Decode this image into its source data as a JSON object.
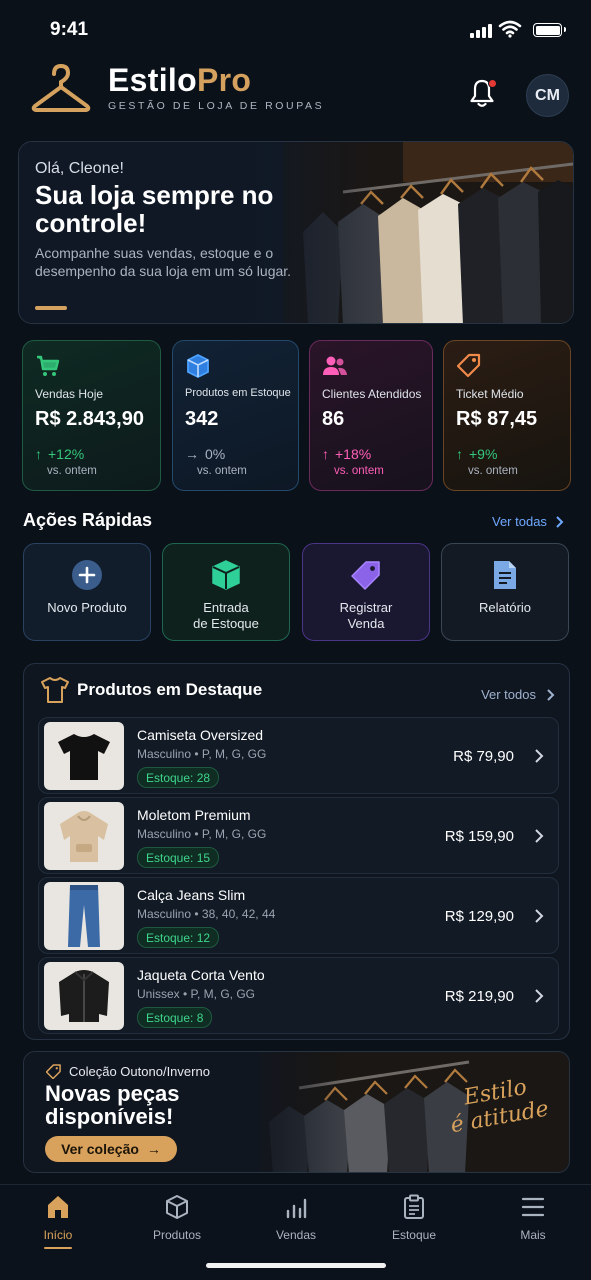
{
  "status_bar": {
    "time": "9:41"
  },
  "header": {
    "brand_part1": "Estilo",
    "brand_part2": "Pro",
    "tagline": "GESTÃO DE LOJA DE ROUPAS",
    "avatar_initials": "CM"
  },
  "hero": {
    "greeting": "Olá, Cleone!",
    "title": "Sua loja sempre no controle!",
    "description": "Acompanhe suas vendas, estoque e o desempenho da sua loja em um só lugar."
  },
  "stats": [
    {
      "label": "Vendas Hoje",
      "value": "R$ 2.843,90",
      "change": "+12%",
      "compare": "vs. ontem",
      "icon": "cart-icon",
      "color": "#34c77b"
    },
    {
      "label": "Produtos em Estoque",
      "value": "342",
      "change": "0%",
      "compare": "vs. ontem",
      "icon": "box-icon",
      "color": "#4ea3ff"
    },
    {
      "label": "Clientes Atendidos",
      "value": "86",
      "change": "+18%",
      "compare": "vs. ontem",
      "icon": "users-icon",
      "color": "#ff5fb8"
    },
    {
      "label": "Ticket Médio",
      "value": "R$ 87,45",
      "change": "+9%",
      "compare": "vs. ontem",
      "icon": "tag-icon",
      "color": "#f08a4b"
    }
  ],
  "quick_actions": {
    "title": "Ações Rápidas",
    "link": "Ver todas",
    "items": [
      {
        "label": "Novo Produto",
        "icon": "plus-icon"
      },
      {
        "label": "Entrada\nde Estoque",
        "icon": "box-in-icon"
      },
      {
        "label": "Registrar\nVenda",
        "icon": "tag-icon"
      },
      {
        "label": "Relatório",
        "icon": "document-icon"
      }
    ]
  },
  "featured": {
    "title": "Produtos em Destaque",
    "link": "Ver todos",
    "products": [
      {
        "name": "Camiseta Oversized",
        "meta": "Masculino  •  P, M, G, GG",
        "stock": "Estoque: 28",
        "price": "R$ 79,90",
        "image": "tshirt-image"
      },
      {
        "name": "Moletom Premium",
        "meta": "Masculino  •  P, M, G, GG",
        "stock": "Estoque: 15",
        "price": "R$ 159,90",
        "image": "hoodie-image"
      },
      {
        "name": "Calça Jeans Slim",
        "meta": "Masculino  •  38, 40, 42, 44",
        "stock": "Estoque: 12",
        "price": "R$ 129,90",
        "image": "jeans-image"
      },
      {
        "name": "Jaqueta Corta Vento",
        "meta": "Unissex  •  P, M, G, GG",
        "stock": "Estoque: 8",
        "price": "R$ 219,90",
        "image": "jacket-image"
      }
    ]
  },
  "promo": {
    "tag": "Coleção Outono/Inverno",
    "title": "Novas peças disponíveis!",
    "button": "Ver coleção",
    "script_line1": "Estilo",
    "script_line2": "é atitude"
  },
  "tabbar": {
    "items": [
      {
        "label": "Início",
        "icon": "home-icon",
        "active": true
      },
      {
        "label": "Produtos",
        "icon": "box-icon",
        "active": false
      },
      {
        "label": "Vendas",
        "icon": "bar-chart-icon",
        "active": false
      },
      {
        "label": "Estoque",
        "icon": "clipboard-icon",
        "active": false
      },
      {
        "label": "Mais",
        "icon": "menu-icon",
        "active": false
      }
    ]
  },
  "colors": {
    "background": "#0b1119",
    "accent_gold": "#d9a25c",
    "link_blue": "#6fa8ff",
    "stock_green": "#3fd58c"
  }
}
